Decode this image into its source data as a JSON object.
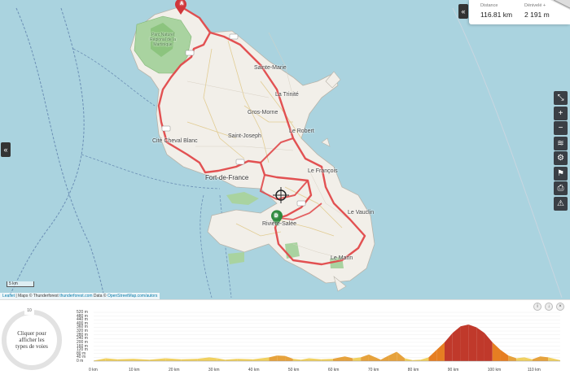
{
  "map": {
    "places": [
      {
        "id": "sainte-marie",
        "name": "Sainte-Marie"
      },
      {
        "id": "la-trinite",
        "name": "La Trinité"
      },
      {
        "id": "gros-morne",
        "name": "Gros-Morne"
      },
      {
        "id": "le-robert",
        "name": "Le Robert"
      },
      {
        "id": "saint-joseph",
        "name": "Saint-Joseph"
      },
      {
        "id": "case-pilote",
        "name": "Cité Cheval Blanc"
      },
      {
        "id": "fort-de-france",
        "name": "Fort-de-France"
      },
      {
        "id": "le-francois",
        "name": "Le François"
      },
      {
        "id": "le-vauclin",
        "name": "Le Vauclin"
      },
      {
        "id": "riviere-salee",
        "name": "Rivière-Salée"
      },
      {
        "id": "le-marin",
        "name": "Le Marin"
      }
    ],
    "park_label": "Parc Naturel Régional de la Martinique",
    "marker_start": "A",
    "marker_end": "D",
    "route_color": "#e0484a",
    "water_color": "#aad3df",
    "land_color": "#f2efe9",
    "scale_label": "5 km",
    "attribution": {
      "leaflet": "Leaflet",
      "tiles": " | Maps © Thunderforest ",
      "tiles_link": "thunderforest.com",
      "data": " Data © ",
      "data_link": "OpenStreetMap.com/autors"
    }
  },
  "stats": {
    "distance_label": "Distance",
    "distance_value": "116.81 km",
    "elevation_label": "Dénivelé +",
    "elevation_value": "2 191 m"
  },
  "tools": [
    "collapse-icon",
    "zoom-in-icon",
    "zoom-out-icon",
    "layers-icon",
    "bike-icon",
    "road-icon",
    "print-icon",
    "warning-icon"
  ],
  "road_types_button": "Cliquer pour afficher les types de voies",
  "ring_label": "10",
  "chart_data": {
    "type": "area",
    "xlabel": "",
    "ylabel": "",
    "x_ticks": [
      "0 km",
      "10 km",
      "20 km",
      "30 km",
      "40 km",
      "50 km",
      "60 km",
      "70 km",
      "80 km",
      "90 km",
      "100 km",
      "110 km"
    ],
    "x_range": [
      0,
      117
    ],
    "y_ticks": [
      "0 m",
      "40 m",
      "80 m",
      "120 m",
      "160 m",
      "200 m",
      "240 m",
      "280 m",
      "320 m",
      "360 m",
      "400 m",
      "440 m",
      "480 m",
      "520 m"
    ],
    "y_range": [
      0,
      520
    ],
    "x": [
      0,
      3,
      6,
      10,
      14,
      18,
      22,
      26,
      29,
      31,
      33,
      36,
      40,
      44,
      46,
      48,
      50,
      52,
      54,
      57,
      60,
      63,
      65,
      67,
      69,
      72,
      74,
      76,
      78,
      80,
      82,
      84,
      86,
      88,
      90,
      92,
      94,
      96,
      98,
      100,
      102,
      104,
      106,
      108,
      110,
      112,
      114,
      117
    ],
    "y": [
      5,
      30,
      20,
      25,
      15,
      30,
      20,
      25,
      40,
      30,
      15,
      25,
      20,
      40,
      60,
      55,
      25,
      15,
      30,
      20,
      25,
      50,
      30,
      40,
      70,
      15,
      60,
      100,
      30,
      10,
      15,
      40,
      120,
      200,
      300,
      370,
      390,
      360,
      300,
      200,
      120,
      60,
      30,
      40,
      20,
      50,
      40,
      10
    ]
  },
  "chart_buttons": [
    "info-icon",
    "download-icon",
    "close-icon"
  ]
}
